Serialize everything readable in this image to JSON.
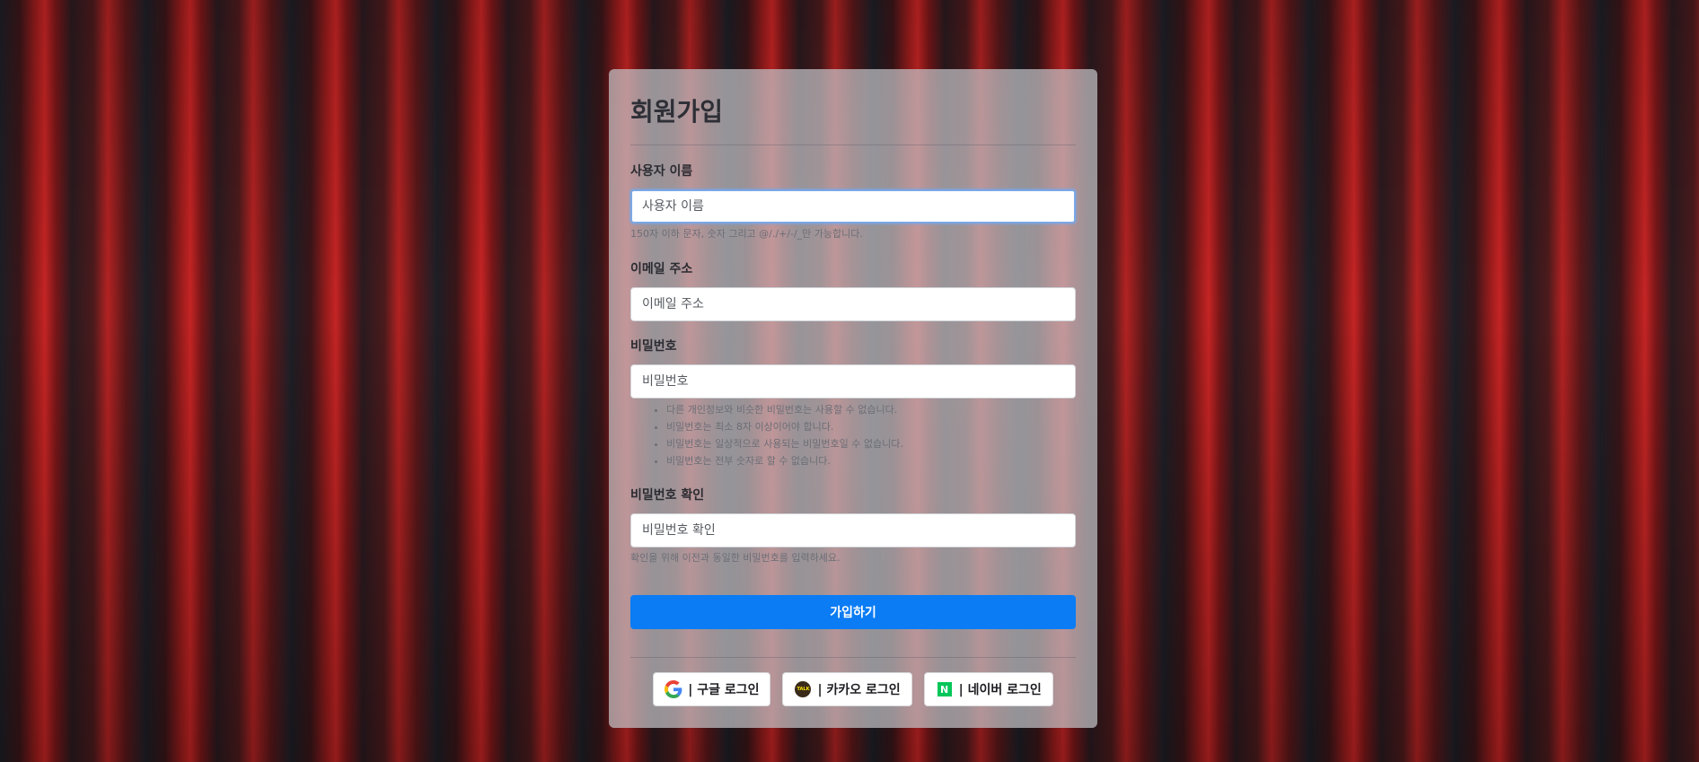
{
  "page": {
    "title": "회원가입"
  },
  "form": {
    "username": {
      "label": "사용자 이름",
      "placeholder": "사용자 이름",
      "value": "",
      "help": "150자 이하 문자, 숫자 그리고 @/./+/-/_만 가능합니다."
    },
    "email": {
      "label": "이메일 주소",
      "placeholder": "이메일 주소",
      "value": ""
    },
    "password": {
      "label": "비밀번호",
      "placeholder": "비밀번호",
      "value": "",
      "rules": [
        "다른 개인정보와 비슷한 비밀번호는 사용할 수 없습니다.",
        "비밀번호는 최소 8자 이상이어야 합니다.",
        "비밀번호는 일상적으로 사용되는 비밀번호일 수 없습니다.",
        "비밀번호는 전부 숫자로 할 수 없습니다."
      ]
    },
    "password_confirm": {
      "label": "비밀번호 확인",
      "placeholder": "비밀번호 확인",
      "value": "",
      "help": "확인을 위해 이전과 동일한 비밀번호를 입력하세요."
    },
    "submit_label": "가입하기"
  },
  "social": {
    "google_label": "| 구글 로그인",
    "kakao_label": "| 카카오 로그인",
    "naver_label": "| 네이버 로그인",
    "kakao_icon_text": "TALK",
    "naver_icon_text": "N"
  },
  "colors": {
    "primary": "#0b7cf4",
    "naver_green": "#03c75a",
    "kakao_yellow": "#fee500"
  }
}
